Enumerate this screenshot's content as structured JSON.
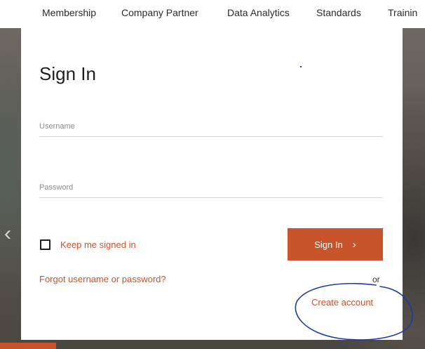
{
  "nav": {
    "items": [
      "Membership",
      "Company Partner",
      "Data Analytics",
      "Standards",
      "Trainin"
    ]
  },
  "modal": {
    "title": "Sign In",
    "username_placeholder": "Username",
    "username_value": "",
    "password_placeholder": "Password",
    "password_value": "",
    "keep_signed_in_label": "Keep me signed in",
    "keep_signed_in_checked": false,
    "sign_in_label": "Sign In",
    "forgot_label": "Forgot username or password?",
    "or_label": "or",
    "create_account_label": "Create account"
  },
  "colors": {
    "accent": "#c8542c",
    "annotation": "#1f3aa8"
  },
  "icons": {
    "close": "close-icon",
    "prev": "chevron-left-icon",
    "sign_in_arrow": "chevron-right-icon"
  }
}
